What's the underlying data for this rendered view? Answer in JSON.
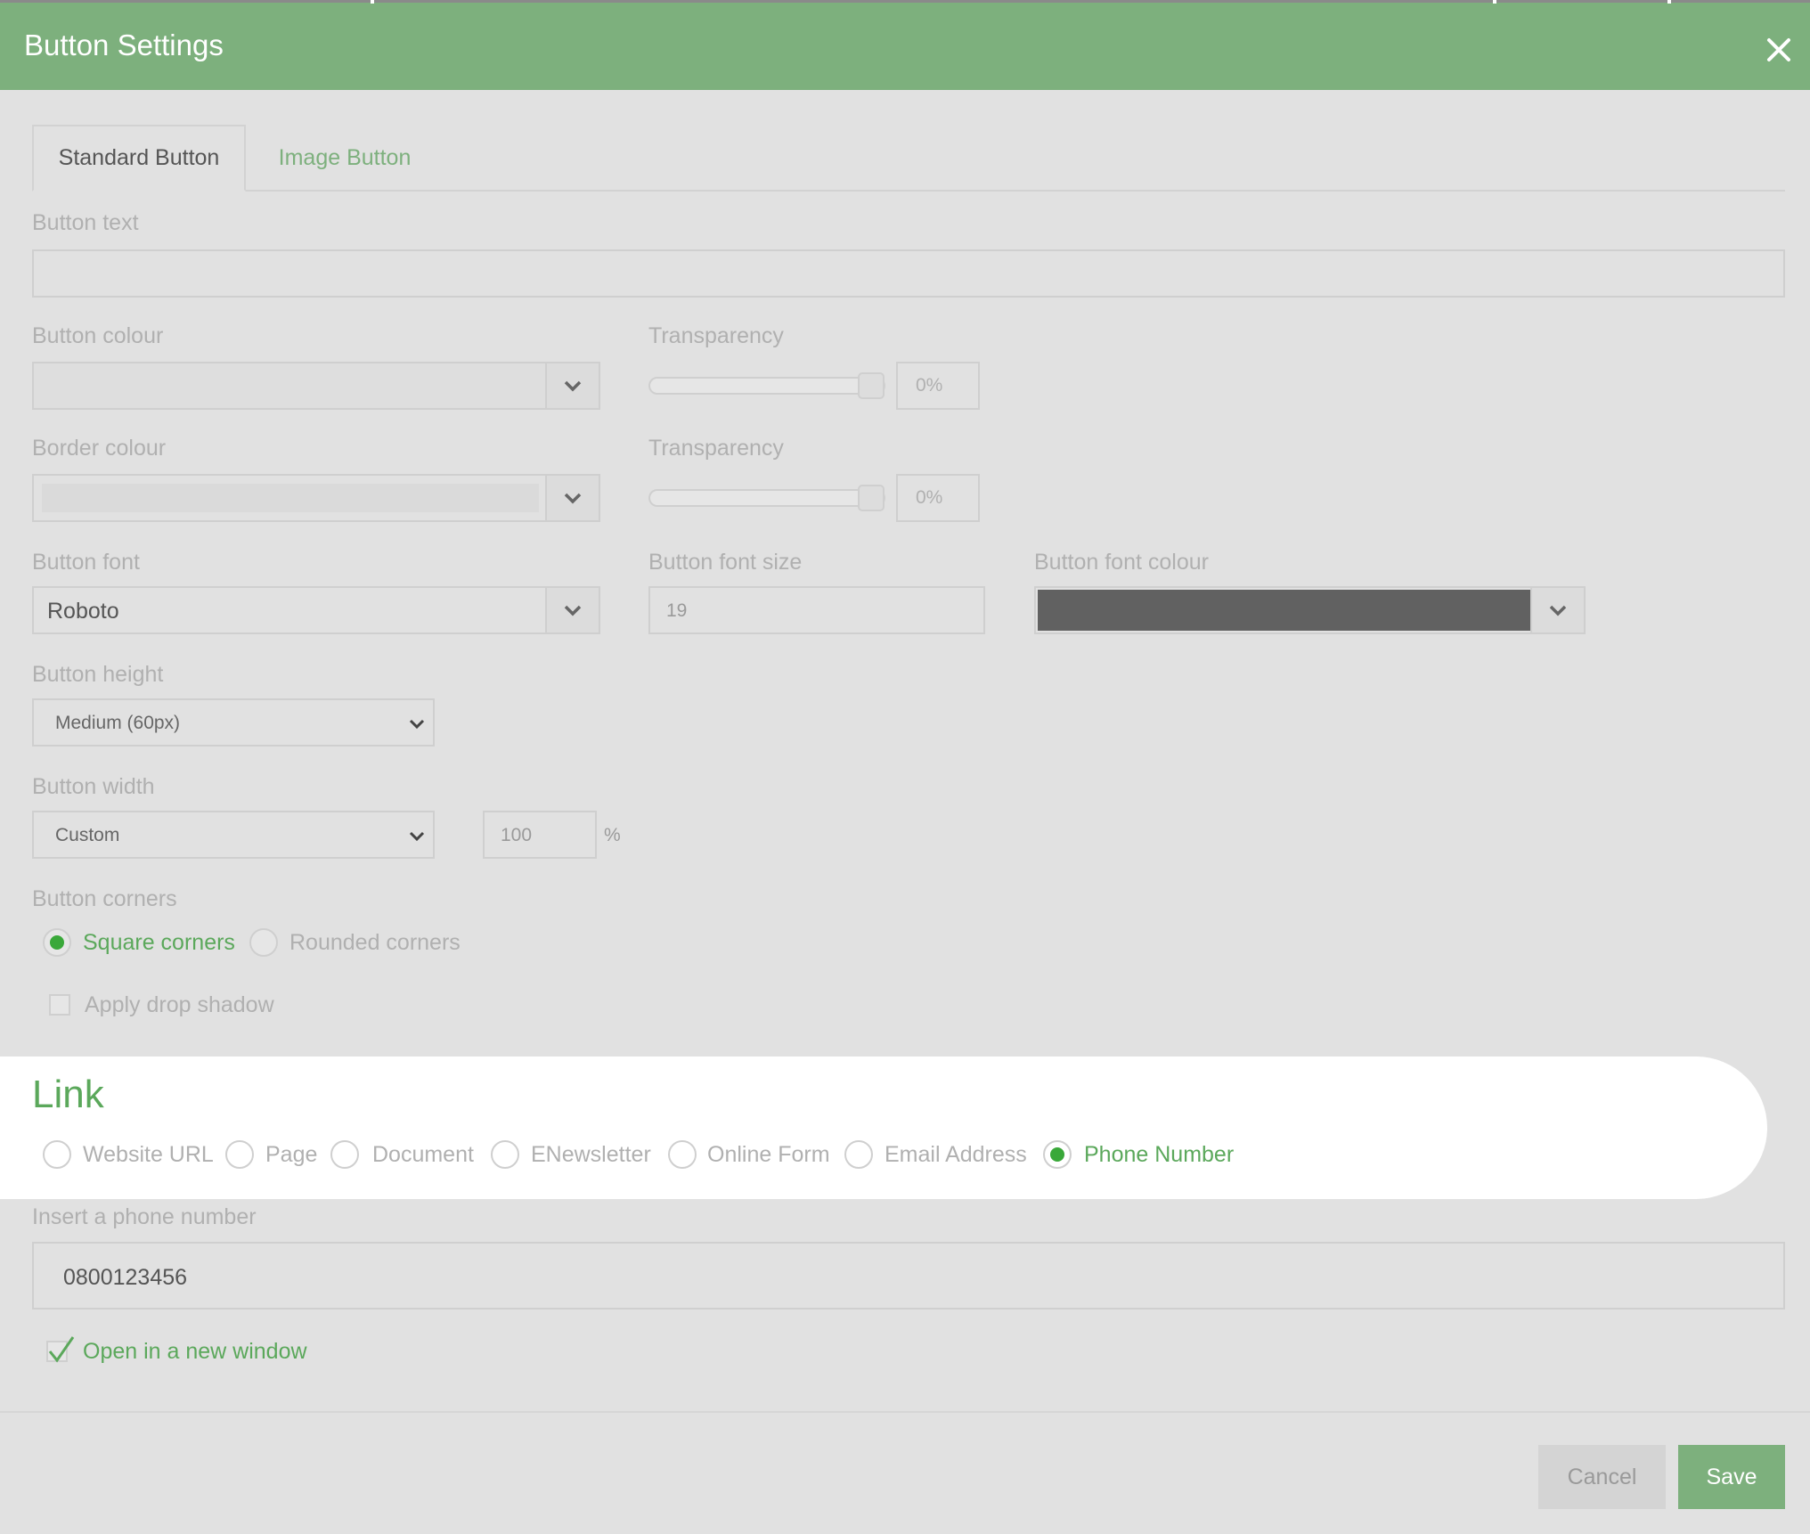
{
  "dialog": {
    "title": "Button Settings"
  },
  "tabs": [
    {
      "label": "Standard Button",
      "active": true
    },
    {
      "label": "Image Button",
      "active": false
    }
  ],
  "form": {
    "button_text": {
      "label": "Button text",
      "value": ""
    },
    "button_colour": {
      "label": "Button colour"
    },
    "button_colour_transparency": {
      "label": "Transparency",
      "value": "0%"
    },
    "border_colour": {
      "label": "Border colour"
    },
    "border_colour_transparency": {
      "label": "Transparency",
      "value": "0%"
    },
    "button_font": {
      "label": "Button font",
      "value": "Roboto"
    },
    "button_font_size": {
      "label": "Button font size",
      "value": "19"
    },
    "button_font_colour": {
      "label": "Button font colour",
      "swatch": "#616161"
    },
    "button_height": {
      "label": "Button height",
      "value": "Medium (60px)"
    },
    "button_width": {
      "label": "Button width",
      "value": "Custom",
      "custom_value": "100",
      "unit": "%"
    },
    "button_corners": {
      "label": "Button corners",
      "options": [
        {
          "label": "Square corners",
          "selected": true
        },
        {
          "label": "Rounded corners",
          "selected": false
        }
      ]
    },
    "drop_shadow": {
      "label": "Apply drop shadow",
      "checked": false
    }
  },
  "link": {
    "title": "Link",
    "options": [
      {
        "label": "Website URL",
        "selected": false
      },
      {
        "label": "Page",
        "selected": false
      },
      {
        "label": "Document",
        "selected": false
      },
      {
        "label": "ENewsletter",
        "selected": false
      },
      {
        "label": "Online Form",
        "selected": false
      },
      {
        "label": "Email Address",
        "selected": false
      },
      {
        "label": "Phone Number",
        "selected": true
      }
    ],
    "phone": {
      "label": "Insert a phone number",
      "value": "0800123456"
    },
    "new_window": {
      "label": "Open in a new window",
      "checked": true
    }
  },
  "footer": {
    "cancel_label": "Cancel",
    "save_label": "Save"
  },
  "colors": {
    "accent": "#7db07d",
    "selected_radio": "#39a839",
    "background": "#e1e1e1",
    "font_colour_swatch": "#616161"
  }
}
